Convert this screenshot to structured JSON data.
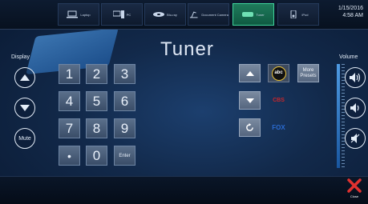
{
  "sources": [
    {
      "label": "Laptop",
      "icon": "laptop-icon",
      "active": false
    },
    {
      "label": "PC",
      "icon": "pc-icon",
      "active": false
    },
    {
      "label": "Blu-ray",
      "icon": "bluray-icon",
      "active": false
    },
    {
      "label": "Document Camera",
      "icon": "document-camera-icon",
      "active": false
    },
    {
      "label": "Tuner",
      "icon": "tuner-icon",
      "active": true
    },
    {
      "label": "iPod",
      "icon": "ipod-icon",
      "active": false
    }
  ],
  "datetime": {
    "date": "1/15/2016",
    "time": "4:58 AM"
  },
  "title": "Tuner",
  "display": {
    "label": "Display",
    "up_icon": "arrow-up-icon",
    "down_icon": "arrow-down-icon",
    "mute_label": "Mute"
  },
  "keypad": {
    "keys": [
      "1",
      "2",
      "3",
      "4",
      "5",
      "6",
      "7",
      "8",
      "9",
      "•",
      "0",
      "Enter"
    ]
  },
  "tuner": {
    "up_icon": "arrow-up-icon",
    "down_icon": "arrow-down-icon",
    "refresh_icon": "refresh-icon",
    "presets": [
      {
        "label": "abc"
      },
      {
        "label": "CBS"
      },
      {
        "label": "FOX"
      }
    ],
    "more_presets_label": "More Presets"
  },
  "volume": {
    "label": "Volume",
    "up_icon": "volume-up-icon",
    "down_icon": "volume-down-icon",
    "mute_icon": "volume-mute-icon"
  },
  "close": {
    "label": "Close"
  },
  "colors": {
    "accent": "#3fd39c",
    "close": "#e0312f",
    "background": "#12294a"
  }
}
